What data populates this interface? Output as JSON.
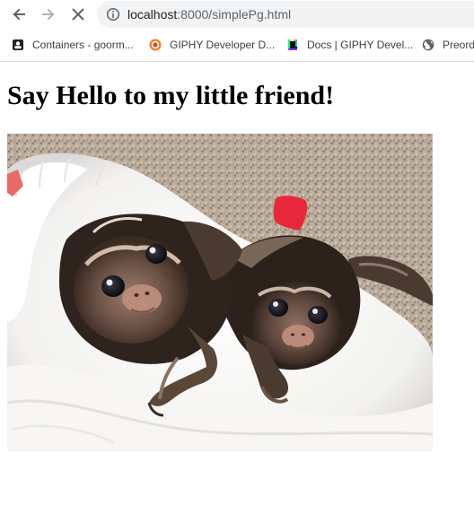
{
  "browser": {
    "url_host": "localhost",
    "url_path": ":8000/simplePg.html",
    "icons": {
      "back": "arrow-left-icon",
      "forward": "arrow-right-icon",
      "stop": "close-icon",
      "info": "info-icon"
    }
  },
  "bookmarks": [
    {
      "label": "Containers - goorm...",
      "icon": "folder-icon"
    },
    {
      "label": "GIPHY Developer D...",
      "icon": "giphy-dev-icon"
    },
    {
      "label": "Docs | GIPHY Devel...",
      "icon": "giphy-docs-icon"
    },
    {
      "label": "Preord",
      "icon": "globe-icon"
    }
  ],
  "page": {
    "heading": "Say Hello to my little friend!",
    "image_subject": "two baby marmoset monkeys on a white fluffy blanket"
  },
  "colors": {
    "toolbar_icon": "#5f6368",
    "omnibox_bg": "#f1f3f4",
    "giphy_orange": "#f57c2b",
    "red_ribbon": "#e8283a"
  }
}
